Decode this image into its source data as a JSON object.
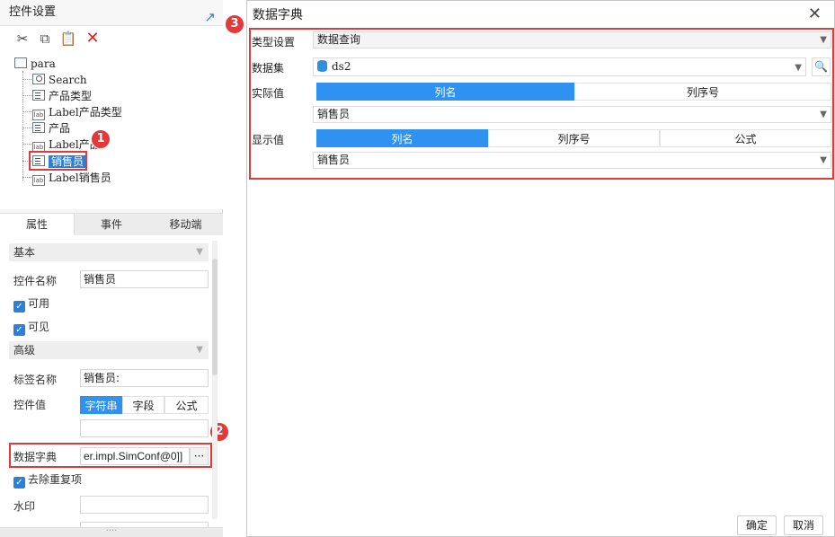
{
  "left_panel": {
    "title": "控件设置",
    "toolbar": {
      "cut": "cut-icon",
      "copy": "copy-icon",
      "paste": "paste-icon",
      "delete": "delete-icon"
    },
    "tree": {
      "root": "para",
      "children": [
        "Search",
        "产品类型",
        "Label产品类型",
        "产品",
        "Label产品",
        "销售员",
        "Label销售员"
      ]
    },
    "tabs": [
      "属性",
      "事件",
      "移动端"
    ],
    "sections": {
      "basic": "基本",
      "advanced": "高级"
    },
    "fields": {
      "widget_name_label": "控件名称",
      "widget_name_value": "销售员",
      "enabled_label": "可用",
      "visible_label": "可见",
      "tag_name_label": "标签名称",
      "tag_name_value": "销售员:",
      "widget_value_label": "控件值",
      "widget_value_options": [
        "字符串",
        "字段",
        "公式"
      ],
      "dict_label": "数据字典",
      "dict_value": "er.impl.SimConf@0]]",
      "dict_more": "···",
      "dedupe_label": "去除重复项",
      "watermark_label": "水印"
    },
    "badges": [
      "1",
      "2"
    ]
  },
  "dialog": {
    "title": "数据字典",
    "badge": "3",
    "type_label": "类型设置",
    "type_value": "数据查询",
    "dataset_label": "数据集",
    "dataset_value": "ds2",
    "actual_label": "实际值",
    "actual_tabs": [
      "列名",
      "列序号"
    ],
    "actual_value": "销售员",
    "display_label": "显示值",
    "display_tabs": [
      "列名",
      "列序号",
      "公式"
    ],
    "display_value": "销售员",
    "ok": "确定",
    "cancel": "取消"
  },
  "colors": {
    "accent": "#2f91f0",
    "highlight_red": "#e23a3a",
    "selection": "#2f7fd8"
  }
}
